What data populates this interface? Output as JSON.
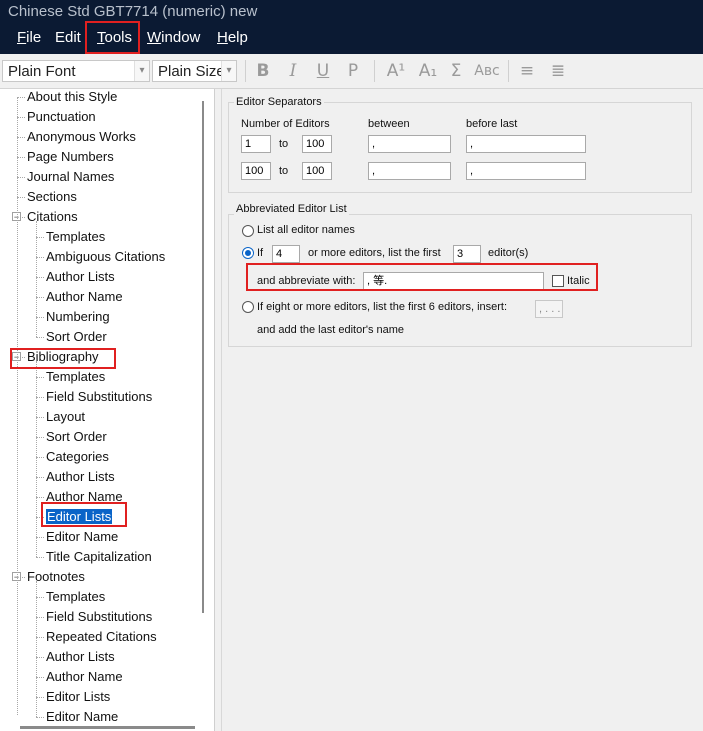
{
  "window": {
    "title": "Chinese Std GBT7714 (numeric) new"
  },
  "menu": [
    {
      "label": "File",
      "u": "F",
      "rest": "ile"
    },
    {
      "label": "Edit",
      "u": "",
      "rest": "Edit"
    },
    {
      "label": "Tools",
      "u": "T",
      "rest": "ools"
    },
    {
      "label": "Window",
      "u": "W",
      "rest": "indow"
    },
    {
      "label": "Help",
      "u": "H",
      "rest": "elp"
    }
  ],
  "toolbar": {
    "font": "Plain Font",
    "size": "Plain Size",
    "bold": "B",
    "italic": "I",
    "underline": "U",
    "plain": "P",
    "superscript": "A¹",
    "subscript": "A₁",
    "symbol": "Σ",
    "small_caps": "Aʙᴄ"
  },
  "tree": [
    {
      "label": "About this Style",
      "level": 1
    },
    {
      "label": "Punctuation",
      "level": 1
    },
    {
      "label": "Anonymous Works",
      "level": 1
    },
    {
      "label": "Page Numbers",
      "level": 1
    },
    {
      "label": "Journal Names",
      "level": 1
    },
    {
      "label": "Sections",
      "level": 1
    },
    {
      "label": "Citations",
      "level": 1,
      "expander": "−"
    },
    {
      "label": "Templates",
      "level": 2
    },
    {
      "label": "Ambiguous Citations",
      "level": 2
    },
    {
      "label": "Author Lists",
      "level": 2
    },
    {
      "label": "Author Name",
      "level": 2
    },
    {
      "label": "Numbering",
      "level": 2
    },
    {
      "label": "Sort Order",
      "level": 2
    },
    {
      "label": "Bibliography",
      "level": 1,
      "expander": "−"
    },
    {
      "label": "Templates",
      "level": 2
    },
    {
      "label": "Field Substitutions",
      "level": 2
    },
    {
      "label": "Layout",
      "level": 2
    },
    {
      "label": "Sort Order",
      "level": 2
    },
    {
      "label": "Categories",
      "level": 2
    },
    {
      "label": "Author Lists",
      "level": 2
    },
    {
      "label": "Author Name",
      "level": 2
    },
    {
      "label": "Editor Lists",
      "level": 2,
      "selected": true
    },
    {
      "label": "Editor Name",
      "level": 2
    },
    {
      "label": "Title Capitalization",
      "level": 2
    },
    {
      "label": "Footnotes",
      "level": 1,
      "expander": "−"
    },
    {
      "label": "Templates",
      "level": 2
    },
    {
      "label": "Field Substitutions",
      "level": 2
    },
    {
      "label": "Repeated Citations",
      "level": 2
    },
    {
      "label": "Author Lists",
      "level": 2
    },
    {
      "label": "Author Name",
      "level": 2
    },
    {
      "label": "Editor Lists",
      "level": 2
    },
    {
      "label": "Editor Name",
      "level": 2
    }
  ],
  "separators": {
    "title": "Editor Separators",
    "col_number": "Number of Editors",
    "col_between": "between",
    "col_before_last": "before last",
    "to": "to",
    "rows": [
      {
        "from": "1",
        "to": "100",
        "between": ",",
        "before_last": ","
      },
      {
        "from": "100",
        "to": "100",
        "between": ",",
        "before_last": ","
      }
    ]
  },
  "abbrev": {
    "title": "Abbreviated Editor List",
    "list_all": "List all editor names",
    "if": "If",
    "if_count": "4",
    "more_editors": "or more editors, list the first",
    "first_count": "3",
    "editors_suffix": "editor(s)",
    "abbreviate_with": "and abbreviate with:",
    "abbreviation": ", 等.",
    "italic": "Italic",
    "eight_or_more": "If eight or more editors, list the first 6 editors, insert:",
    "insert_value": ", . . .",
    "add_last": "and add the last editor's name"
  }
}
